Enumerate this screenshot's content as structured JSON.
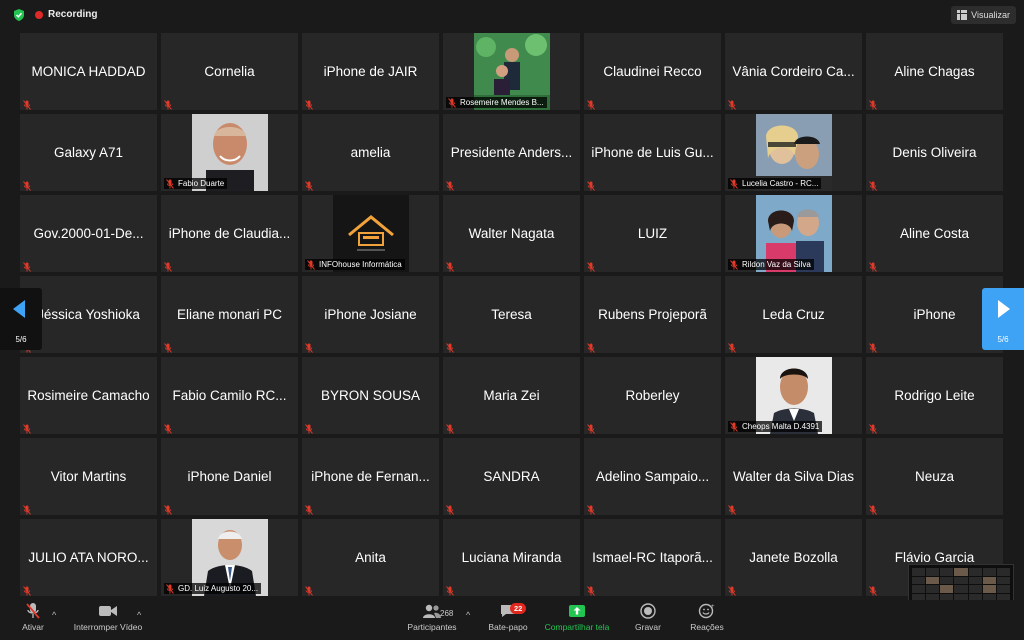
{
  "topbar": {
    "recording_label": "Recording",
    "view_label": "Visualizar"
  },
  "nav": {
    "page_left": "5/6",
    "page_right": "5/6"
  },
  "participants": [
    {
      "name": "MONICA HADDAD"
    },
    {
      "name": "Cornelia"
    },
    {
      "name": "iPhone de JAIR"
    },
    {
      "name": "Rosemeire Mendes B...",
      "photo": "couple-photo"
    },
    {
      "name": "Claudinei Recco"
    },
    {
      "name": "Vânia Cordeiro Ca..."
    },
    {
      "name": "Aline Chagas"
    },
    {
      "name": "Galaxy A71"
    },
    {
      "name": "Fabio Duarte",
      "photo": "man-portrait"
    },
    {
      "name": "amelia"
    },
    {
      "name": "Presidente Anders..."
    },
    {
      "name": "iPhone de Luis Gu..."
    },
    {
      "name": "Lucelia Castro - RC...",
      "photo": "selfie-photo"
    },
    {
      "name": "Denis Oliveira"
    },
    {
      "name": "Gov.2000-01-De..."
    },
    {
      "name": "iPhone de Claudia..."
    },
    {
      "name": "INFOhouse Informática",
      "photo": "house-logo"
    },
    {
      "name": "Walter Nagata"
    },
    {
      "name": "LUIZ"
    },
    {
      "name": "Rildon Vaz da Silva",
      "photo": "couple-photo-2"
    },
    {
      "name": "Aline Costa"
    },
    {
      "name": "Jéssica Yoshioka"
    },
    {
      "name": "Eliane monari PC"
    },
    {
      "name": "iPhone Josiane"
    },
    {
      "name": "Teresa"
    },
    {
      "name": "Rubens Projeporã"
    },
    {
      "name": "Leda Cruz"
    },
    {
      "name": "iPhone"
    },
    {
      "name": "Rosimeire Camacho"
    },
    {
      "name": "Fabio Camilo RC..."
    },
    {
      "name": "BYRON SOUSA"
    },
    {
      "name": "Maria Zei"
    },
    {
      "name": "Roberley"
    },
    {
      "name": "Cheops Malta D.4391",
      "photo": "man-portrait-2"
    },
    {
      "name": "Rodrigo Leite"
    },
    {
      "name": "Vitor Martins"
    },
    {
      "name": "iPhone Daniel"
    },
    {
      "name": "iPhone de Fernan..."
    },
    {
      "name": "SANDRA"
    },
    {
      "name": "Adelino Sampaio..."
    },
    {
      "name": "Walter da Silva Dias"
    },
    {
      "name": "Neuza"
    },
    {
      "name": "JULIO ATA NORO..."
    },
    {
      "name": "GD. Luiz Augusto 20...",
      "photo": "man-suit"
    },
    {
      "name": "Anita"
    },
    {
      "name": "Luciana Miranda"
    },
    {
      "name": "Ismael-RC Itaporã..."
    },
    {
      "name": "Janete Bozolla"
    },
    {
      "name": "Flávio Garcia"
    }
  ],
  "toolbar": {
    "mute_label": "Ativar",
    "video_label": "Interromper Vídeo",
    "participants_label": "Participantes",
    "participants_count": "268",
    "chat_label": "Bate-papo",
    "chat_badge": "22",
    "share_label": "Compartilhar tela",
    "record_label": "Gravar",
    "reactions_label": "Reações"
  },
  "colors": {
    "accent": "#3ea2f5",
    "share_green": "#23c552",
    "recording_red": "#e02828",
    "mic_muted": "#e03a2a"
  }
}
